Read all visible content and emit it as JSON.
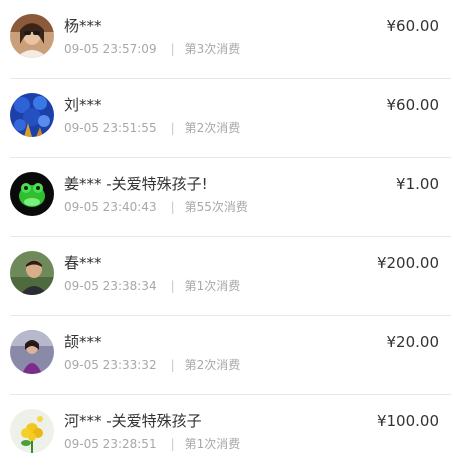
{
  "currency_symbol": "¥",
  "records": [
    {
      "name": "杨***",
      "time": "09-05 23:57:09",
      "count": "第3次消费",
      "amount": "¥60.00",
      "avatar": "woman-sunglasses-photo"
    },
    {
      "name": "刘***",
      "time": "09-05 23:51:55",
      "count": "第2次消费",
      "amount": "¥60.00",
      "avatar": "blue-flowers-photo"
    },
    {
      "name": "姜*** -关爱特殊孩子!",
      "time": "09-05 23:40:43",
      "count": "第55次消费",
      "amount": "¥1.00",
      "avatar": "green-frog-photo"
    },
    {
      "name": "春***",
      "time": "09-05 23:38:34",
      "count": "第1次消费",
      "amount": "¥200.00",
      "avatar": "man-outdoor-photo"
    },
    {
      "name": "颉***",
      "time": "09-05 23:33:32",
      "count": "第2次消费",
      "amount": "¥20.00",
      "avatar": "person-purple-photo"
    },
    {
      "name": "河*** -关爱特殊孩子",
      "time": "09-05 23:28:51",
      "count": "第1次消费",
      "amount": "¥100.00",
      "avatar": "yellow-flower-photo"
    }
  ]
}
